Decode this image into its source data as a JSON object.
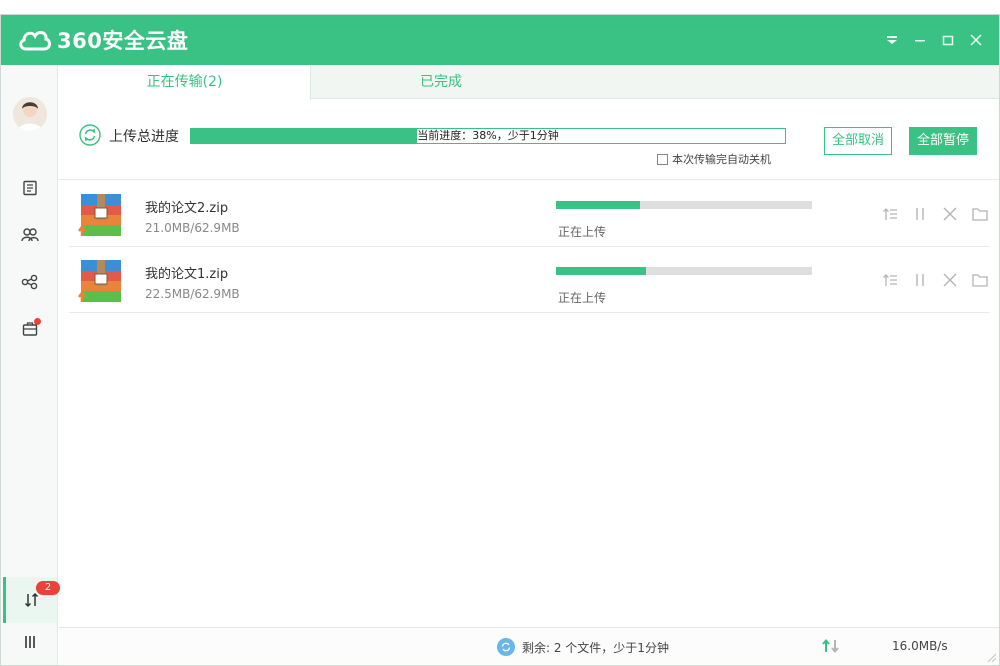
{
  "app": {
    "logo_text": "360安全云盘"
  },
  "colors": {
    "brand": "#3ac184",
    "badge": "#e9423a"
  },
  "window_controls": [
    "dropdown-icon",
    "minimize-icon",
    "maximize-icon",
    "close-icon"
  ],
  "sidebar": {
    "items": [
      "document-icon",
      "contacts-icon",
      "share-icon",
      "toolbox-icon"
    ],
    "transfer_badge": "2"
  },
  "tabs": {
    "in_progress": "正在传输(2)",
    "completed": "已完成"
  },
  "overall": {
    "label": "上传总进度",
    "progress": 0.38,
    "progress_text": "当前进度：38%，少于1分钟",
    "auto_shutdown_label": "本次传输完自动关机",
    "cancel_all_label": "全部取消",
    "pause_all_label": "全部暂停"
  },
  "files": [
    {
      "name": "我的论文2.zip",
      "size": "21.0MB/62.9MB",
      "progress": 0.33,
      "status": "正在上传"
    },
    {
      "name": "我的论文1.zip",
      "size": "22.5MB/62.9MB",
      "progress": 0.35,
      "status": "正在上传"
    }
  ],
  "statusbar": {
    "remaining": "剩余: 2 个文件，少于1分钟",
    "speed": "16.0MB/s"
  }
}
